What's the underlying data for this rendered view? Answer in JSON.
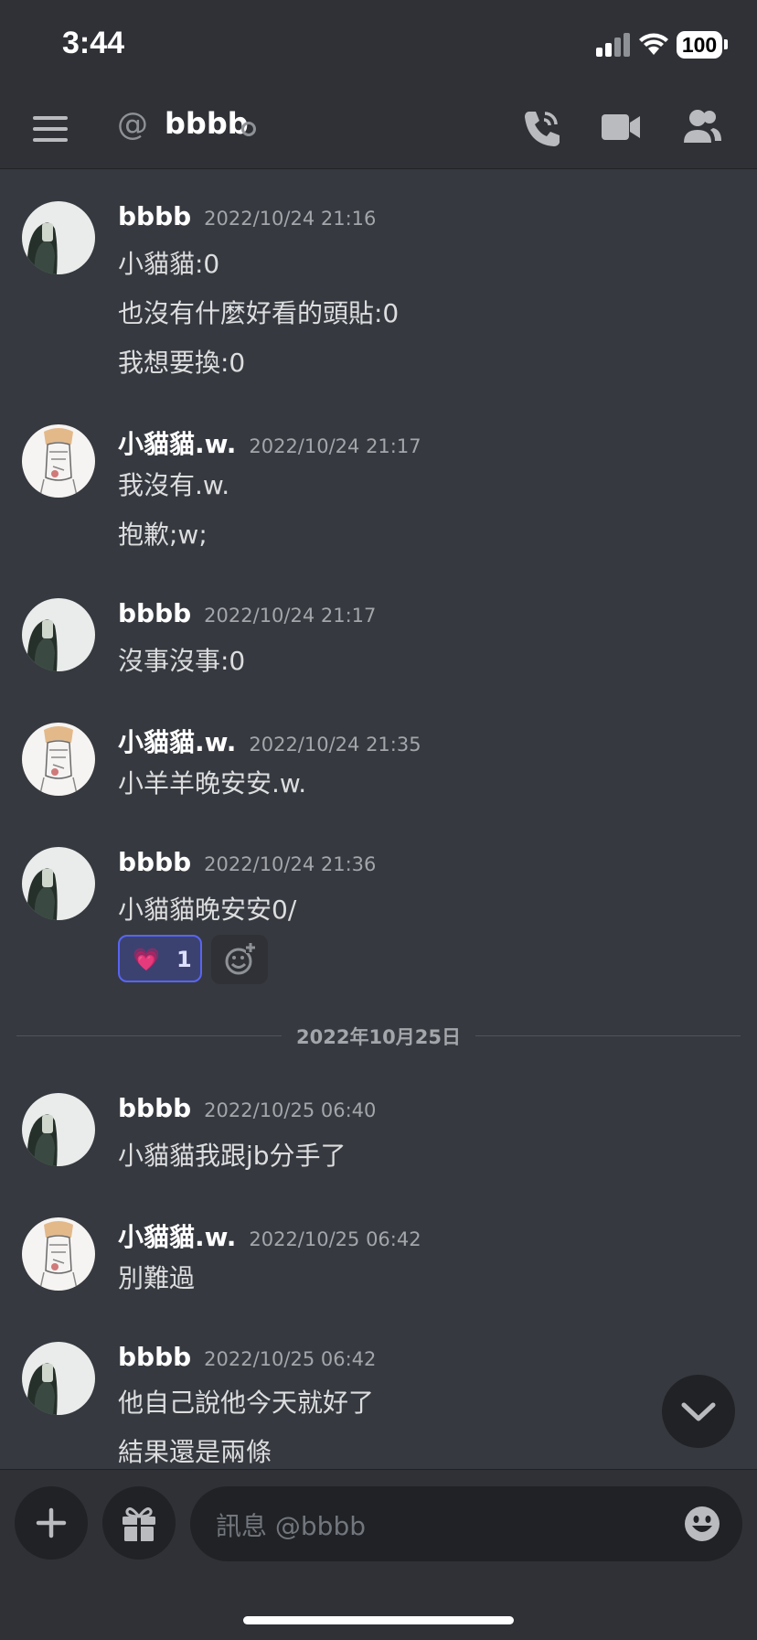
{
  "status_bar": {
    "time": "3:44",
    "battery": "100"
  },
  "header": {
    "at_symbol": "@",
    "username": "bbbb"
  },
  "messages": [
    {
      "author": "bbbb",
      "timestamp": "2022/10/24 21:16",
      "lines": [
        "小貓貓:0",
        "也沒有什麼好看的頭貼:0",
        "我想要換:0"
      ]
    },
    {
      "author": "小貓貓.w.",
      "timestamp": "2022/10/24 21:17",
      "lines": [
        "我沒有.w.",
        "抱歉;w;"
      ]
    },
    {
      "author": "bbbb",
      "timestamp": "2022/10/24 21:17",
      "lines": [
        "沒事沒事:0"
      ]
    },
    {
      "author": "小貓貓.w.",
      "timestamp": "2022/10/24 21:35",
      "lines": [
        "小羊羊晚安安.w."
      ]
    },
    {
      "author": "bbbb",
      "timestamp": "2022/10/24 21:36",
      "lines": [
        "小貓貓晚安安0/"
      ],
      "reaction": {
        "emoji": "💗",
        "count": "1"
      }
    },
    {
      "author": "bbbb",
      "timestamp": "2022/10/25 06:40",
      "lines": [
        "小貓貓我跟jb分手了"
      ]
    },
    {
      "author": "小貓貓.w.",
      "timestamp": "2022/10/25 06:42",
      "lines": [
        "別難過"
      ]
    },
    {
      "author": "bbbb",
      "timestamp": "2022/10/25 06:42",
      "lines": [
        "他自己說他今天就好了",
        "結果還是兩條"
      ]
    }
  ],
  "date_divider": "2022年10月25日",
  "composer": {
    "placeholder": "訊息 @bbbb"
  },
  "icons": {
    "menu": "hamburger-menu-icon",
    "call": "phone-call-icon",
    "video": "video-camera-icon",
    "members": "members-icon",
    "add": "plus-icon",
    "gift": "gift-icon",
    "emoji": "emoji-smile-icon",
    "jump": "chevron-down-icon",
    "add_reaction": "add-reaction-icon"
  },
  "colors": {
    "background": "#36393f",
    "header": "#2f3136",
    "input": "#202225",
    "accent": "#5865f2"
  }
}
